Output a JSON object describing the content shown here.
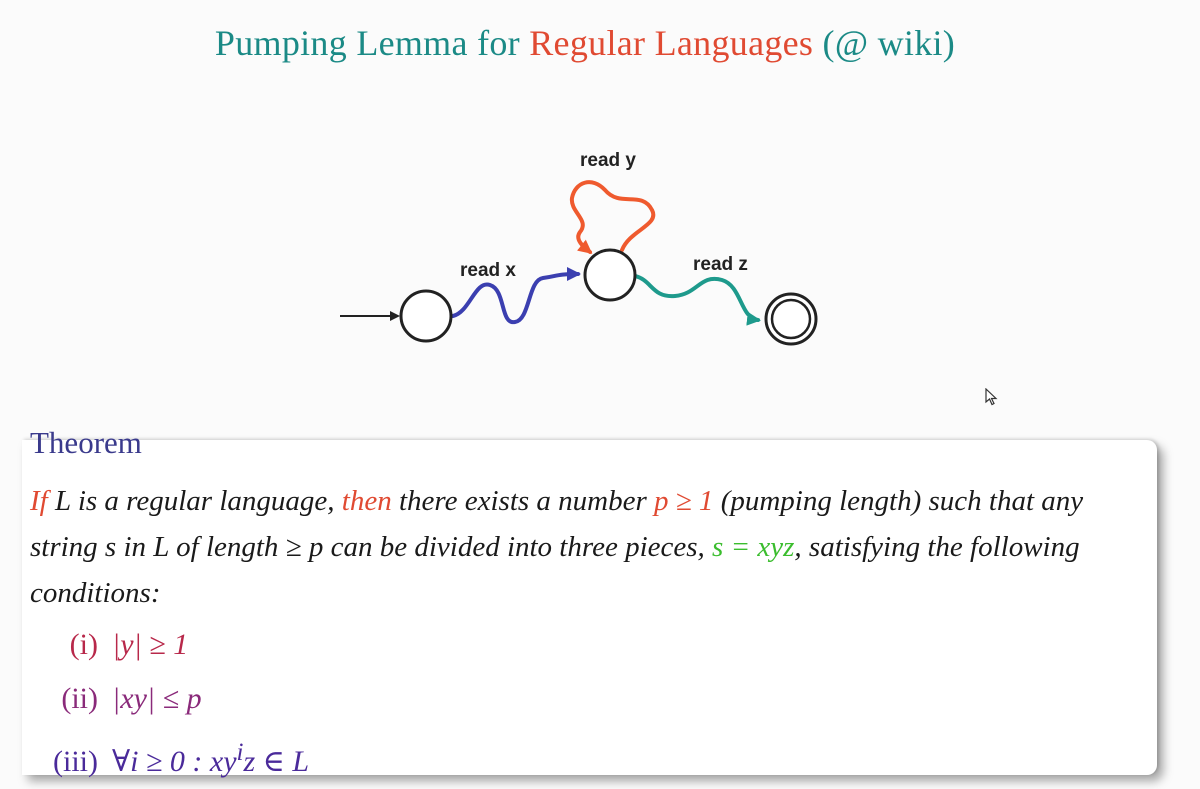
{
  "title": {
    "part1": "Pumping Lemma for ",
    "part2": "Regular Languages",
    "part3": " (@ wiki)"
  },
  "diagram": {
    "label_x": "read x",
    "label_y": "read y",
    "label_z": "read z",
    "colors": {
      "x": "#3b3fb0",
      "y": "#ef5a2e",
      "z": "#1e9a8c"
    }
  },
  "theorem": {
    "heading": "Theorem",
    "kw_if": "If",
    "t1": " L is a regular language, ",
    "kw_then": "then",
    "t2": " there exists a number ",
    "p_cond": "p ≥ 1",
    "t3": " (pumping length) such that any string s in L of length ≥ p can be divided into three pieces, ",
    "s_eq": "s = xyz",
    "t4": ", satisfying the following conditions:"
  },
  "conditions": [
    {
      "num": "(i)",
      "expr": "|y| ≥ 1"
    },
    {
      "num": "(ii)",
      "expr": "|xy| ≤ p"
    },
    {
      "num": "(iii)",
      "expr_a": "∀i ≥ 0 : xy",
      "sup": "i",
      "expr_b": "z ∈ L"
    }
  ]
}
